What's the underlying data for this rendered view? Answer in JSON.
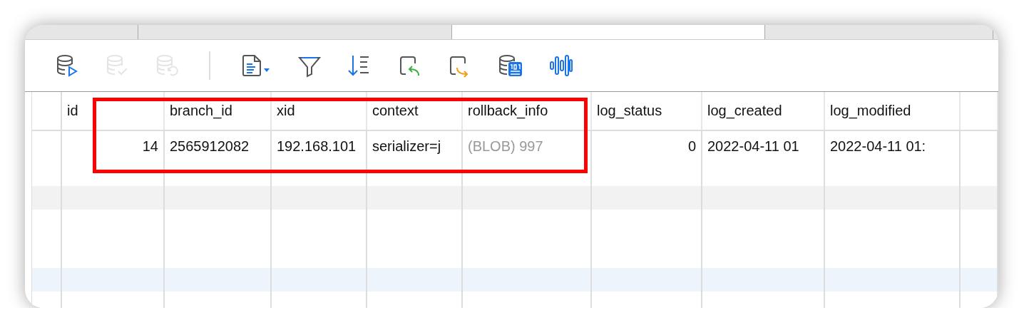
{
  "tabs": [
    {
      "selected": false
    },
    {
      "selected": false
    },
    {
      "selected": true
    },
    {
      "selected": false
    }
  ],
  "toolbar": [
    {
      "kind": "db-run",
      "disabled": false
    },
    {
      "kind": "db-check",
      "disabled": true
    },
    {
      "kind": "db-undo",
      "disabled": true
    },
    {
      "kind": "divider"
    },
    {
      "kind": "document",
      "disabled": false
    },
    {
      "kind": "filter",
      "disabled": false
    },
    {
      "kind": "sort",
      "disabled": false
    },
    {
      "kind": "back",
      "disabled": false
    },
    {
      "kind": "forward",
      "disabled": false
    },
    {
      "kind": "db-binary",
      "disabled": false
    },
    {
      "kind": "waveform",
      "disabled": false
    }
  ],
  "table": {
    "columns": [
      {
        "name": "id",
        "kind": "number"
      },
      {
        "name": "branch_id",
        "kind": "text"
      },
      {
        "name": "xid",
        "kind": "text"
      },
      {
        "name": "context",
        "kind": "text"
      },
      {
        "name": "rollback_info",
        "kind": "blob"
      },
      {
        "name": "log_status",
        "kind": "number"
      },
      {
        "name": "log_created",
        "kind": "text"
      },
      {
        "name": "log_modified",
        "kind": "text"
      }
    ],
    "rows": [
      [
        "14",
        "2565912082",
        "192.168.101",
        "serializer=j",
        "(BLOB) 997",
        "0",
        "2022-04-11 01",
        "2022-04-11 01:"
      ]
    ]
  }
}
